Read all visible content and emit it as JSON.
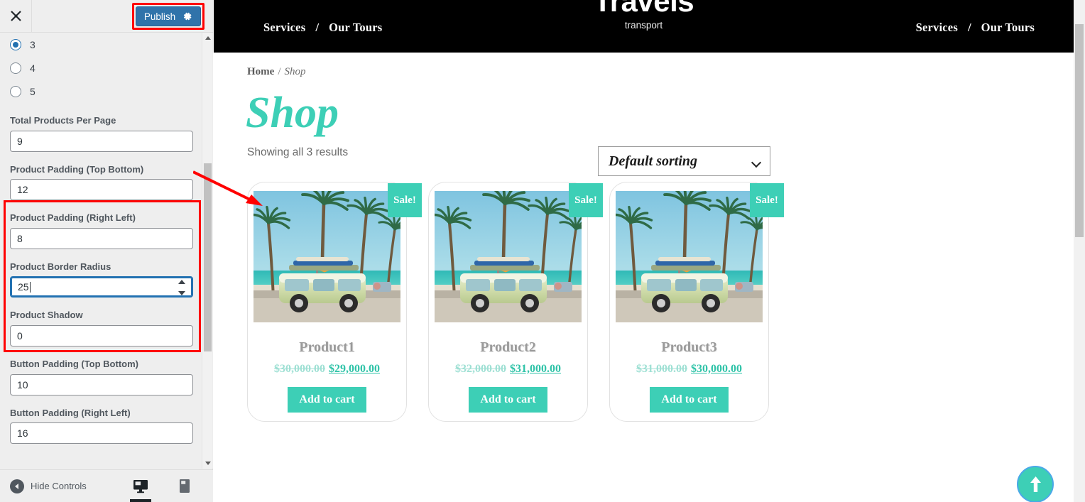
{
  "customizer": {
    "close_icon": "close-icon",
    "publish_label": "Publish",
    "gear_icon": "gear-icon",
    "radio_group": {
      "options": [
        {
          "label": "3",
          "selected": true
        },
        {
          "label": "4",
          "selected": false
        },
        {
          "label": "5",
          "selected": false
        }
      ]
    },
    "fields": [
      {
        "label": "Total Products Per Page",
        "value": "9",
        "focused": false,
        "spinner": false,
        "highlighted": false
      },
      {
        "label": "Product Padding (Top Bottom)",
        "value": "12",
        "focused": false,
        "spinner": false,
        "highlighted": true
      },
      {
        "label": "Product Padding (Right Left)",
        "value": "8",
        "focused": false,
        "spinner": false,
        "highlighted": true
      },
      {
        "label": "Product Border Radius",
        "value": "25",
        "focused": true,
        "spinner": true,
        "highlighted": true
      },
      {
        "label": "Product Shadow",
        "value": "0",
        "focused": false,
        "spinner": false,
        "highlighted": false
      },
      {
        "label": "Button Padding (Top Bottom)",
        "value": "10",
        "focused": false,
        "spinner": false,
        "highlighted": false
      },
      {
        "label": "Button Padding (Right Left)",
        "value": "16",
        "focused": false,
        "spinner": false,
        "highlighted": false
      }
    ],
    "footer": {
      "hide_controls_label": "Hide Controls",
      "devices": [
        {
          "name": "desktop",
          "active": true
        },
        {
          "name": "tablet",
          "active": false
        },
        {
          "name": "mobile",
          "active": false
        }
      ]
    },
    "annotation": {
      "highlight_color": "#ff0000",
      "arrow_color": "#ff0000"
    }
  },
  "site": {
    "header": {
      "nav_left": [
        "Services",
        "Our Tours"
      ],
      "nav_right": [
        "Services",
        "Our Tours"
      ],
      "nav_separator": "/",
      "brand_name": "Travels",
      "brand_tagline": "transport",
      "background": "#000000"
    },
    "breadcrumb": {
      "home": "Home",
      "separator": "/",
      "current": "Shop"
    },
    "page_title": "Shop",
    "result_count": "Showing all 3 results",
    "sorting": {
      "selected": "Default sorting",
      "chevron_icon": "chevron-down-icon"
    },
    "accent_color": "#3dcfb6",
    "products": [
      {
        "name": "Product1",
        "badge": "Sale!",
        "price_old": "$30,000.00",
        "price_new": "$29,000.00",
        "button_label": "Add to cart",
        "image_alt": "vw-van-beach-palms-photo"
      },
      {
        "name": "Product2",
        "badge": "Sale!",
        "price_old": "$32,000.00",
        "price_new": "$31,000.00",
        "button_label": "Add to cart",
        "image_alt": "vw-van-beach-palms-photo"
      },
      {
        "name": "Product3",
        "badge": "Sale!",
        "price_old": "$31,000.00",
        "price_new": "$30,000.00",
        "button_label": "Add to cart",
        "image_alt": "vw-van-beach-palms-photo"
      }
    ],
    "back_to_top_icon": "arrow-up-icon"
  }
}
